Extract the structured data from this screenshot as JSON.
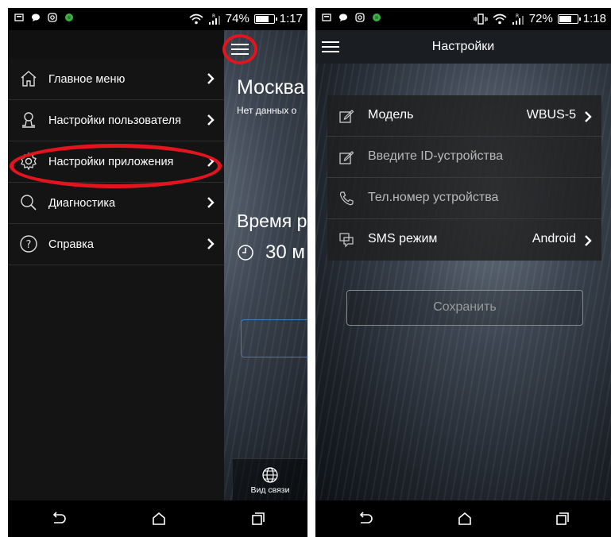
{
  "left_screen": {
    "status": {
      "battery": "74%",
      "battery_level": 0.74,
      "time": "1:17",
      "signal_flag": "R"
    },
    "drawer": {
      "items": [
        {
          "label": "Главное меню",
          "icon": "home-icon"
        },
        {
          "label": "Настройки пользователя",
          "icon": "user-icon"
        },
        {
          "label": "Настройки приложения",
          "icon": "gear-icon"
        },
        {
          "label": "Диагностика",
          "icon": "search-icon"
        },
        {
          "label": "Справка",
          "icon": "help-icon"
        }
      ]
    },
    "main": {
      "title": "Москва",
      "subtitle": "Нет данных о",
      "time_label": "Время р",
      "duration": "30 м",
      "connection_tab": "Вид связи"
    },
    "annotation_color": "#e4141e"
  },
  "right_screen": {
    "status": {
      "battery": "72%",
      "battery_level": 0.72,
      "time": "1:18",
      "signal_flag": "R"
    },
    "title": "Настройки",
    "settings": [
      {
        "label": "Модель",
        "value": "WBUS-5",
        "icon": "edit-icon",
        "has_chevron": true
      },
      {
        "label": "Введите ID-устройства",
        "value": "",
        "icon": "edit-icon",
        "has_chevron": false,
        "placeholder": true
      },
      {
        "label": "Тел.номер устройства",
        "value": "",
        "icon": "phone-icon",
        "has_chevron": false,
        "placeholder": true
      },
      {
        "label": "SMS режим",
        "value": "Android",
        "icon": "sms-icon",
        "has_chevron": true
      }
    ],
    "save_button": "Сохранить"
  }
}
